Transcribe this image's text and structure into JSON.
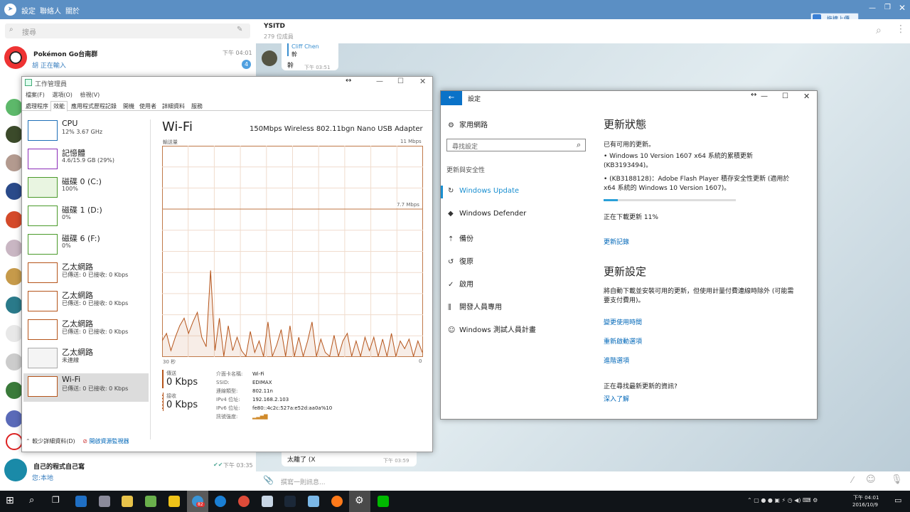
{
  "telegram": {
    "menu": [
      "設定",
      "聯絡人",
      "關於"
    ],
    "search_placeholder": "搜尋",
    "chats": [
      {
        "name": "Pokémon Go台南群",
        "time": "下午 04:01",
        "preview": "胡 正在輸入",
        "badge": "4"
      },
      {
        "name": "自己的程式自己寫",
        "time": "下午 03:35",
        "preview": "您:本地"
      }
    ],
    "header_title": "YSITD",
    "header_sub": "279 位成員",
    "msgs": [
      {
        "sender": "Cliff Chen",
        "quote": "幹",
        "text": "幹",
        "time": "下午 03:51"
      },
      {
        "text": "太離了 (X",
        "time": "下午 03:59"
      }
    ],
    "composer_placeholder": "撰寫一則訊息...",
    "upload_label": "拖拽上傳"
  },
  "task_manager": {
    "title": "工作管理員",
    "menu": [
      "檔案(F)",
      "選項(O)",
      "檢視(V)"
    ],
    "tabs": [
      "處理程序",
      "效能",
      "應用程式歷程記錄",
      "開機",
      "使用者",
      "詳細資料",
      "服務"
    ],
    "sidebar": [
      {
        "name": "CPU",
        "value": "12% 3.67 GHz",
        "color": "#1e6fb8"
      },
      {
        "name": "記憶體",
        "value": "4.6/15.9 GB (29%)",
        "color": "#8b2bb8"
      },
      {
        "name": "磁碟 0 (C:)",
        "value": "100%",
        "color": "#4a9a2a"
      },
      {
        "name": "磁碟 1 (D:)",
        "value": "0%",
        "color": "#4a9a2a"
      },
      {
        "name": "磁碟 6 (F:)",
        "value": "0%",
        "color": "#4a9a2a"
      },
      {
        "name": "乙太網路",
        "value": "已傳送: 0 已接收: 0 Kbps",
        "color": "#b5541a"
      },
      {
        "name": "乙太網路",
        "value": "已傳送: 0 已接收: 0 Kbps",
        "color": "#b5541a"
      },
      {
        "name": "乙太網路",
        "value": "已傳送: 0 已接收: 0 Kbps",
        "color": "#b5541a"
      },
      {
        "name": "乙太網路",
        "value": "未連線",
        "color": "#aaaaaa"
      },
      {
        "name": "Wi-Fi",
        "value": "已傳送: 0 已接收: 0 Kbps",
        "color": "#b5541a"
      }
    ],
    "main_title": "Wi-Fi",
    "adapter": "150Mbps Wireless 802.11bgn Nano USB Adapter",
    "graph_label": "輸送量",
    "graph_max": "11 Mbps",
    "graph_mid": "7.7 Mbps",
    "time_left": "30 秒",
    "time_right": "0",
    "send_label": "傳送",
    "send_value": "0 Kbps",
    "recv_label": "接收",
    "recv_value": "0 Kbps",
    "details": [
      [
        "介面卡名稱:",
        "Wi-Fi"
      ],
      [
        "SSID:",
        "EDIMAX"
      ],
      [
        "連線類型:",
        "802.11n"
      ],
      [
        "IPv4 位址:",
        "192.168.2.103"
      ],
      [
        "IPv6 位址:",
        "fe80::4c2c:527a:e52d:aa0a%10"
      ],
      [
        "訊號強度:",
        ""
      ]
    ],
    "fewer_details": "較少詳細資料(D)",
    "open_resmon": "開啟資源監視器"
  },
  "settings": {
    "title": "設定",
    "home": "家用網路",
    "search_placeholder": "尋找設定",
    "section": "更新與安全性",
    "nav": [
      "Windows Update",
      "Windows Defender",
      "備份",
      "復原",
      "啟用",
      "開發人員專用",
      "Windows 測試人員計畫"
    ],
    "status_title": "更新狀態",
    "available": "已有可用的更新。",
    "update1": "• Windows 10 Version 1607 x64 系統的累積更新 (KB3193494)。",
    "update2": "• (KB3188128)：Adobe Flash Player 積存安全性更新 (適用於 x64 系統的 Windows 10 Version 1607)。",
    "progress": 0.11,
    "downloading": "正在下載更新 11%",
    "history": "更新記錄",
    "settings_title": "更新設定",
    "settings_desc": "將自動下載並安裝可用的更新，但使用計量付費連線時除外 (可能需要支付費用)。",
    "link1": "變更使用時間",
    "link2": "重新啟動選項",
    "link3": "進階選項",
    "ask": "正在尋找最新更新的資訊?",
    "learn": "深入了解"
  },
  "taskbar": {
    "time": "下午 04:01",
    "date": "2016/10/9",
    "badge": "82"
  },
  "chart_data": {
    "type": "area",
    "title": "Wi-Fi",
    "ylabel": "輸送量",
    "ylim": [
      0,
      11
    ],
    "x": [
      0,
      1,
      2,
      3,
      4,
      5,
      6,
      7,
      8,
      9,
      10,
      11,
      12,
      13,
      14,
      15,
      16,
      17,
      18,
      19,
      20,
      21,
      22,
      23,
      24,
      25,
      26,
      27,
      28,
      29,
      30,
      31,
      32,
      33,
      34,
      35,
      36,
      37,
      38,
      39,
      40,
      41,
      42,
      43,
      44,
      45,
      46,
      47,
      48,
      49,
      50,
      51,
      52,
      53,
      54,
      55,
      56,
      57,
      58,
      59
    ],
    "series": [
      {
        "values": [
          0.8,
          1.2,
          0.3,
          1.0,
          1.6,
          2.0,
          1.2,
          1.8,
          2.3,
          1.0,
          0.5,
          4.5,
          0.3,
          2.0,
          0,
          1.6,
          0.3,
          1.0,
          0.3,
          0,
          1.3,
          0.2,
          0.8,
          0,
          1.8,
          0,
          0.6,
          1.4,
          0,
          1.6,
          0,
          1.0,
          0,
          0.8,
          1.8,
          0,
          0.9,
          0.2,
          0,
          1.1,
          0,
          0.8,
          1.2,
          0,
          0.8,
          0,
          1.0,
          0.3,
          1.0,
          0,
          0.9,
          0,
          1.2,
          0,
          0.8,
          0.4,
          0.9,
          0,
          0.8,
          0.2
        ]
      }
    ]
  }
}
